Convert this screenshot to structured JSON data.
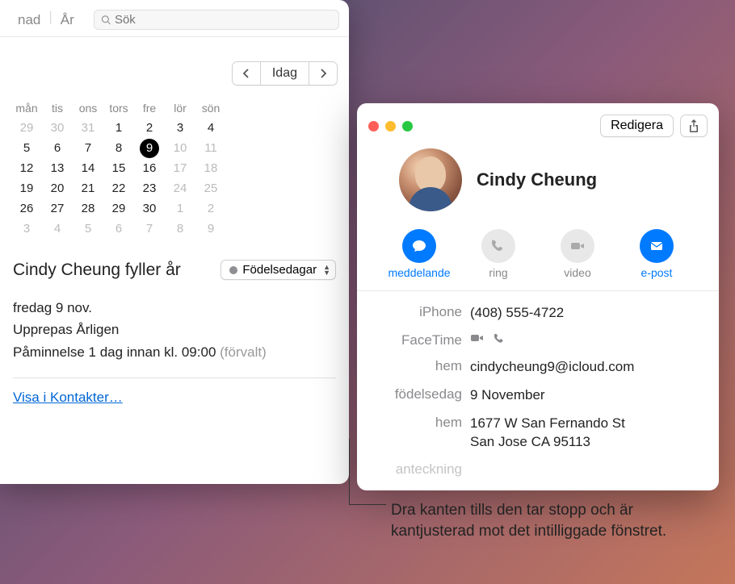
{
  "calendar": {
    "view_tabs": {
      "month": "nad",
      "year": "År"
    },
    "search_placeholder": "Sök",
    "today_label": "Idag",
    "dow": [
      "mån",
      "tis",
      "ons",
      "tors",
      "fre",
      "lör",
      "sön"
    ],
    "weeks": [
      [
        {
          "d": "29",
          "m": true
        },
        {
          "d": "30",
          "m": true
        },
        {
          "d": "31",
          "m": true
        },
        {
          "d": "1"
        },
        {
          "d": "2"
        },
        {
          "d": "3"
        },
        {
          "d": "4"
        }
      ],
      [
        {
          "d": "5"
        },
        {
          "d": "6"
        },
        {
          "d": "7"
        },
        {
          "d": "8"
        },
        {
          "d": "9",
          "t": true
        },
        {
          "d": "10",
          "m": true
        },
        {
          "d": "11",
          "m": true
        }
      ],
      [
        {
          "d": "12"
        },
        {
          "d": "13"
        },
        {
          "d": "14"
        },
        {
          "d": "15"
        },
        {
          "d": "16"
        },
        {
          "d": "17",
          "m": true
        },
        {
          "d": "18",
          "m": true
        }
      ],
      [
        {
          "d": "19"
        },
        {
          "d": "20"
        },
        {
          "d": "21"
        },
        {
          "d": "22"
        },
        {
          "d": "23"
        },
        {
          "d": "24",
          "m": true
        },
        {
          "d": "25",
          "m": true
        }
      ],
      [
        {
          "d": "26"
        },
        {
          "d": "27"
        },
        {
          "d": "28"
        },
        {
          "d": "29"
        },
        {
          "d": "30"
        },
        {
          "d": "1",
          "m": true
        },
        {
          "d": "2",
          "m": true
        }
      ],
      [
        {
          "d": "3",
          "m": true
        },
        {
          "d": "4",
          "m": true
        },
        {
          "d": "5",
          "m": true
        },
        {
          "d": "6",
          "m": true
        },
        {
          "d": "7",
          "m": true
        },
        {
          "d": "8",
          "m": true
        },
        {
          "d": "9",
          "m": true
        }
      ]
    ],
    "event": {
      "title": "Cindy Cheung fyller år",
      "calendar_name": "Födelsedagar",
      "date": "fredag 9 nov.",
      "repeat": "Upprepas Årligen",
      "reminder": "Påminnelse 1 dag innan kl. 09:00",
      "reminder_default": "(förvalt)",
      "show_in_contacts": "Visa i Kontakter…"
    }
  },
  "contacts": {
    "edit": "Redigera",
    "name": "Cindy Cheung",
    "actions": {
      "message": "meddelande",
      "call": "ring",
      "video": "video",
      "email": "e-post"
    },
    "fields": {
      "iphone_label": "iPhone",
      "iphone_value": "(408) 555-4722",
      "facetime_label": "FaceTime",
      "home_email_label": "hem",
      "home_email_value": "cindycheung9@icloud.com",
      "birthday_label": "födelsedag",
      "birthday_value": "9 November",
      "home_addr_label": "hem",
      "home_addr_line1": "1677 W San Fernando St",
      "home_addr_line2": "San Jose CA 95113",
      "note_label": "anteckning"
    }
  },
  "callout": "Dra kanten tills den tar stopp och är kantjusterad mot det intilliggade fönstret."
}
